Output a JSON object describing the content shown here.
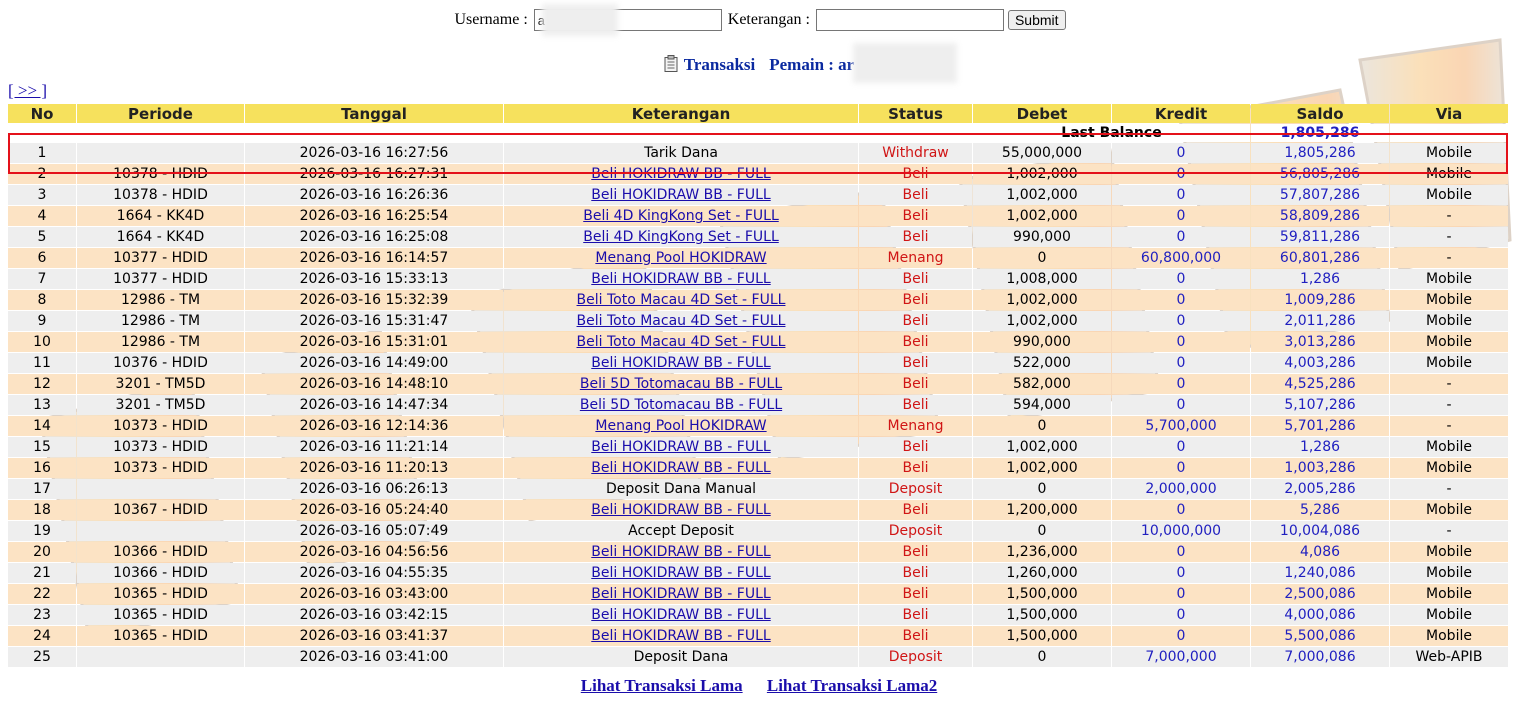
{
  "form": {
    "username_label": "Username :",
    "username_value": "a",
    "keterangan_label": "Keterangan :",
    "keterangan_value": "",
    "submit_label": "Submit"
  },
  "heading": {
    "title": "Transaksi",
    "player_label": "Pemain : ar"
  },
  "more_link": "[ >> ]",
  "table": {
    "headers": [
      "No",
      "Periode",
      "Tanggal",
      "Keterangan",
      "Status",
      "Debet",
      "Kredit",
      "Saldo",
      "Via"
    ],
    "last_balance_label": "Last Balance",
    "last_balance_value": "1,805,286",
    "rows": [
      {
        "no": "1",
        "periode": "",
        "tanggal": "2026-03-16 16:27:56",
        "keterangan": "Tarik Dana",
        "link": false,
        "status": "Withdraw",
        "debet": "55,000,000",
        "kredit": "0",
        "saldo": "1,805,286",
        "via": "Mobile"
      },
      {
        "no": "2",
        "periode": "10378 - HDID",
        "tanggal": "2026-03-16 16:27:31",
        "keterangan": "Beli HOKIDRAW BB - FULL",
        "link": true,
        "status": "Beli",
        "debet": "1,002,000",
        "kredit": "0",
        "saldo": "56,805,286",
        "via": "Mobile"
      },
      {
        "no": "3",
        "periode": "10378 - HDID",
        "tanggal": "2026-03-16 16:26:36",
        "keterangan": "Beli HOKIDRAW BB - FULL",
        "link": true,
        "status": "Beli",
        "debet": "1,002,000",
        "kredit": "0",
        "saldo": "57,807,286",
        "via": "Mobile"
      },
      {
        "no": "4",
        "periode": "1664 - KK4D",
        "tanggal": "2026-03-16 16:25:54",
        "keterangan": "Beli 4D KingKong Set - FULL",
        "link": true,
        "status": "Beli",
        "debet": "1,002,000",
        "kredit": "0",
        "saldo": "58,809,286",
        "via": "-"
      },
      {
        "no": "5",
        "periode": "1664 - KK4D",
        "tanggal": "2026-03-16 16:25:08",
        "keterangan": "Beli 4D KingKong Set - FULL",
        "link": true,
        "status": "Beli",
        "debet": "990,000",
        "kredit": "0",
        "saldo": "59,811,286",
        "via": "-"
      },
      {
        "no": "6",
        "periode": "10377 - HDID",
        "tanggal": "2026-03-16 16:14:57",
        "keterangan": "Menang Pool HOKIDRAW",
        "link": true,
        "status": "Menang",
        "debet": "0",
        "kredit": "60,800,000",
        "saldo": "60,801,286",
        "via": "-"
      },
      {
        "no": "7",
        "periode": "10377 - HDID",
        "tanggal": "2026-03-16 15:33:13",
        "keterangan": "Beli HOKIDRAW BB - FULL",
        "link": true,
        "status": "Beli",
        "debet": "1,008,000",
        "kredit": "0",
        "saldo": "1,286",
        "via": "Mobile"
      },
      {
        "no": "8",
        "periode": "12986 - TM",
        "tanggal": "2026-03-16 15:32:39",
        "keterangan": "Beli Toto Macau 4D Set - FULL",
        "link": true,
        "status": "Beli",
        "debet": "1,002,000",
        "kredit": "0",
        "saldo": "1,009,286",
        "via": "Mobile"
      },
      {
        "no": "9",
        "periode": "12986 - TM",
        "tanggal": "2026-03-16 15:31:47",
        "keterangan": "Beli Toto Macau 4D Set - FULL",
        "link": true,
        "status": "Beli",
        "debet": "1,002,000",
        "kredit": "0",
        "saldo": "2,011,286",
        "via": "Mobile"
      },
      {
        "no": "10",
        "periode": "12986 - TM",
        "tanggal": "2026-03-16 15:31:01",
        "keterangan": "Beli Toto Macau 4D Set - FULL",
        "link": true,
        "status": "Beli",
        "debet": "990,000",
        "kredit": "0",
        "saldo": "3,013,286",
        "via": "Mobile"
      },
      {
        "no": "11",
        "periode": "10376 - HDID",
        "tanggal": "2026-03-16 14:49:00",
        "keterangan": "Beli HOKIDRAW BB - FULL",
        "link": true,
        "status": "Beli",
        "debet": "522,000",
        "kredit": "0",
        "saldo": "4,003,286",
        "via": "Mobile"
      },
      {
        "no": "12",
        "periode": "3201 - TM5D",
        "tanggal": "2026-03-16 14:48:10",
        "keterangan": "Beli 5D Totomacau BB - FULL",
        "link": true,
        "status": "Beli",
        "debet": "582,000",
        "kredit": "0",
        "saldo": "4,525,286",
        "via": "-"
      },
      {
        "no": "13",
        "periode": "3201 - TM5D",
        "tanggal": "2026-03-16 14:47:34",
        "keterangan": "Beli 5D Totomacau BB - FULL",
        "link": true,
        "status": "Beli",
        "debet": "594,000",
        "kredit": "0",
        "saldo": "5,107,286",
        "via": "-"
      },
      {
        "no": "14",
        "periode": "10373 - HDID",
        "tanggal": "2026-03-16 12:14:36",
        "keterangan": "Menang Pool HOKIDRAW",
        "link": true,
        "status": "Menang",
        "debet": "0",
        "kredit": "5,700,000",
        "saldo": "5,701,286",
        "via": "-"
      },
      {
        "no": "15",
        "periode": "10373 - HDID",
        "tanggal": "2026-03-16 11:21:14",
        "keterangan": "Beli HOKIDRAW BB - FULL",
        "link": true,
        "status": "Beli",
        "debet": "1,002,000",
        "kredit": "0",
        "saldo": "1,286",
        "via": "Mobile"
      },
      {
        "no": "16",
        "periode": "10373 - HDID",
        "tanggal": "2026-03-16 11:20:13",
        "keterangan": "Beli HOKIDRAW BB - FULL",
        "link": true,
        "status": "Beli",
        "debet": "1,002,000",
        "kredit": "0",
        "saldo": "1,003,286",
        "via": "Mobile"
      },
      {
        "no": "17",
        "periode": "",
        "tanggal": "2026-03-16 06:26:13",
        "keterangan": "Deposit Dana Manual",
        "link": false,
        "status": "Deposit",
        "debet": "0",
        "kredit": "2,000,000",
        "saldo": "2,005,286",
        "via": "-"
      },
      {
        "no": "18",
        "periode": "10367 - HDID",
        "tanggal": "2026-03-16 05:24:40",
        "keterangan": "Beli HOKIDRAW BB - FULL",
        "link": true,
        "status": "Beli",
        "debet": "1,200,000",
        "kredit": "0",
        "saldo": "5,286",
        "via": "Mobile"
      },
      {
        "no": "19",
        "periode": "",
        "tanggal": "2026-03-16 05:07:49",
        "keterangan": "Accept Deposit",
        "link": false,
        "status": "Deposit",
        "debet": "0",
        "kredit": "10,000,000",
        "saldo": "10,004,086",
        "via": "-"
      },
      {
        "no": "20",
        "periode": "10366 - HDID",
        "tanggal": "2026-03-16 04:56:56",
        "keterangan": "Beli HOKIDRAW BB - FULL",
        "link": true,
        "status": "Beli",
        "debet": "1,236,000",
        "kredit": "0",
        "saldo": "4,086",
        "via": "Mobile"
      },
      {
        "no": "21",
        "periode": "10366 - HDID",
        "tanggal": "2026-03-16 04:55:35",
        "keterangan": "Beli HOKIDRAW BB - FULL",
        "link": true,
        "status": "Beli",
        "debet": "1,260,000",
        "kredit": "0",
        "saldo": "1,240,086",
        "via": "Mobile"
      },
      {
        "no": "22",
        "periode": "10365 - HDID",
        "tanggal": "2026-03-16 03:43:00",
        "keterangan": "Beli HOKIDRAW BB - FULL",
        "link": true,
        "status": "Beli",
        "debet": "1,500,000",
        "kredit": "0",
        "saldo": "2,500,086",
        "via": "Mobile"
      },
      {
        "no": "23",
        "periode": "10365 - HDID",
        "tanggal": "2026-03-16 03:42:15",
        "keterangan": "Beli HOKIDRAW BB - FULL",
        "link": true,
        "status": "Beli",
        "debet": "1,500,000",
        "kredit": "0",
        "saldo": "4,000,086",
        "via": "Mobile"
      },
      {
        "no": "24",
        "periode": "10365 - HDID",
        "tanggal": "2026-03-16 03:41:37",
        "keterangan": "Beli HOKIDRAW BB - FULL",
        "link": true,
        "status": "Beli",
        "debet": "1,500,000",
        "kredit": "0",
        "saldo": "5,500,086",
        "via": "Mobile"
      },
      {
        "no": "25",
        "periode": "",
        "tanggal": "2026-03-16 03:41:00",
        "keterangan": "Deposit Dana",
        "link": false,
        "status": "Deposit",
        "debet": "0",
        "kredit": "7,000,000",
        "saldo": "7,000,086",
        "via": "Web-APIB"
      }
    ]
  },
  "footer": {
    "link1": "Lihat Transaksi Lama",
    "link2": "Lihat Transaksi Lama2"
  },
  "colors": {
    "header_bg": "#f6e15d",
    "row_odd": "#eeeeee",
    "row_even": "#fce3c4",
    "blue_text": "#2020c0",
    "red_text": "#d01515",
    "highlight_border": "#e4111a"
  }
}
